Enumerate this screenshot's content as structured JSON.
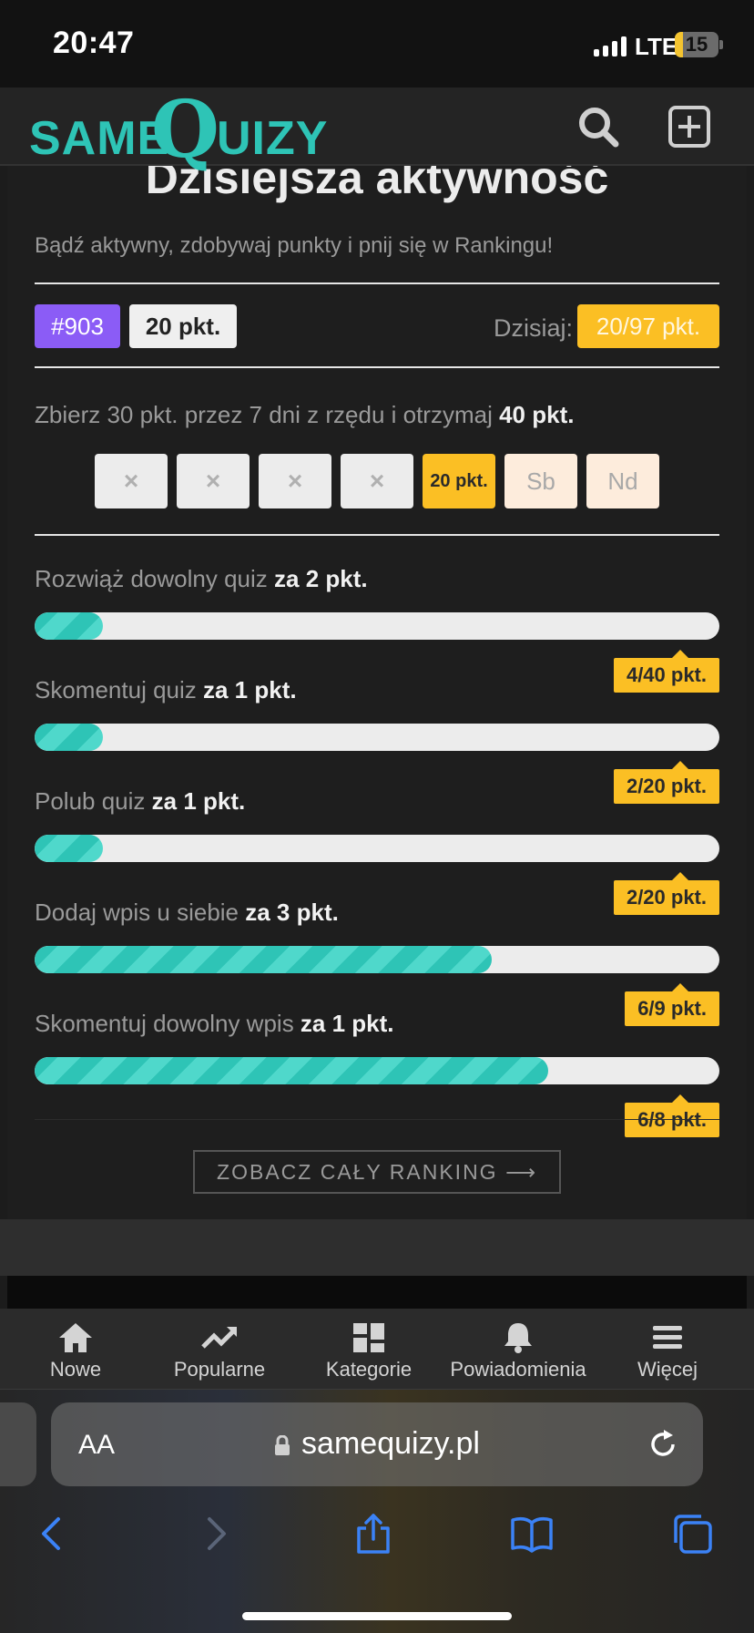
{
  "status_bar": {
    "time": "20:47",
    "network": "LTE",
    "battery": "15",
    "battery_level": 0.15
  },
  "header": {
    "logo_same": "SAME",
    "logo_q": "Q",
    "logo_rest": "UIZY"
  },
  "card": {
    "title": "Dzisiejsza aktywność",
    "subtitle": "Bądź aktywny, zdobywaj punkty i pnij się w Rankingu!",
    "rank": "#903",
    "points": "20 pkt.",
    "today_label": "Dzisiaj:",
    "today_value": "20/97 pkt.",
    "streak_text": "Zbierz 30 pkt. przez 7 dni z rzędu i otrzymaj ",
    "streak_bonus": "40 pkt.",
    "days": [
      {
        "label": "×",
        "state": "done"
      },
      {
        "label": "×",
        "state": "done"
      },
      {
        "label": "×",
        "state": "done"
      },
      {
        "label": "×",
        "state": "done"
      },
      {
        "label": "20 pkt.",
        "state": "today"
      },
      {
        "label": "Sb",
        "state": "future"
      },
      {
        "label": "Nd",
        "state": "future"
      }
    ],
    "tasks": [
      {
        "label": "Rozwiąż dowolny quiz ",
        "reward": "za 2 pkt.",
        "progress": "4/40 pkt.",
        "fraction": 0.1
      },
      {
        "label": "Skomentuj quiz ",
        "reward": "za 1 pkt.",
        "progress": "2/20 pkt.",
        "fraction": 0.1
      },
      {
        "label": "Polub quiz ",
        "reward": "za 1 pkt.",
        "progress": "2/20 pkt.",
        "fraction": 0.1
      },
      {
        "label": "Dodaj wpis u siebie ",
        "reward": "za 3 pkt.",
        "progress": "6/9 pkt.",
        "fraction": 0.667
      },
      {
        "label": "Skomentuj dowolny wpis ",
        "reward": "za 1 pkt.",
        "progress": "6/8 pkt.",
        "fraction": 0.75
      }
    ],
    "ranking_button": "ZOBACZ CAŁY RANKING ⟶"
  },
  "bottom_nav": [
    {
      "label": "Nowe",
      "icon": "home-icon"
    },
    {
      "label": "Popularne",
      "icon": "trending-icon"
    },
    {
      "label": "Kategorie",
      "icon": "grid-icon"
    },
    {
      "label": "Powiadomienia",
      "icon": "bell-icon"
    },
    {
      "label": "Więcej",
      "icon": "menu-icon"
    }
  ],
  "browser": {
    "aa_label": "AA",
    "url": "samequizy.pl"
  },
  "colors": {
    "accent": "#2ec4b6",
    "purple": "#8b5cf6",
    "yellow": "#fbbf24",
    "browser_icons": "#3b82f6"
  }
}
